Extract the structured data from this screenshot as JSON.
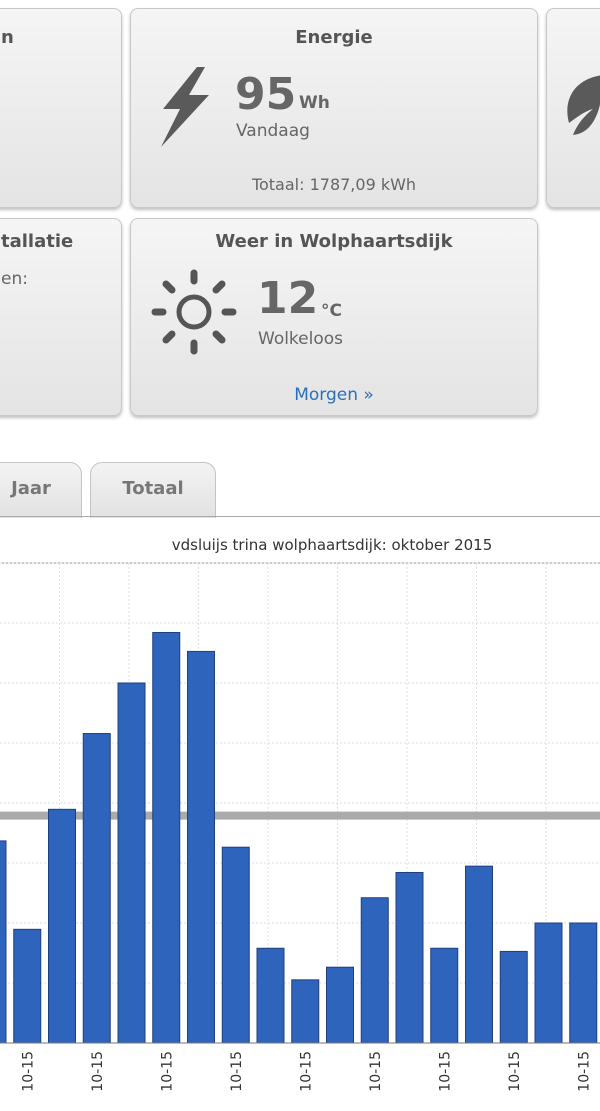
{
  "cards": {
    "left_top_title": "n",
    "energie": {
      "title": "Energie",
      "value": "95",
      "unit": "Wh",
      "label": "Vandaag",
      "total": "Totaal: 1787,09 kWh",
      "icon": "lightning-icon"
    },
    "right_top_icon": "leaf-icon",
    "installatie": {
      "title": "tallatie",
      "line": "en:"
    },
    "weer": {
      "title": "Weer in Wolphaartsdijk",
      "value": "12",
      "unit": "°C",
      "label": "Wolkeloos",
      "link": "Morgen »",
      "icon": "sun-icon"
    }
  },
  "tabs": [
    {
      "label": "Jaar"
    },
    {
      "label": "Totaal"
    }
  ],
  "colors": {
    "bar": "#2f64bd",
    "bar_border": "#1e3f80",
    "link": "#2a6fba",
    "reference_line": "#aaaaaa"
  },
  "chart_data": {
    "type": "bar",
    "title": "vdsluijs trina wolphaartsdijk: oktober 2015",
    "tick_labels": [
      "10-15",
      "10-15",
      "10-15",
      "10-15",
      "10-15",
      "10-15",
      "10-15",
      "10-15",
      "10-15"
    ],
    "values": [
      0.32,
      0.18,
      0.37,
      0.49,
      0.57,
      0.65,
      0.62,
      0.31,
      0.15,
      0.1,
      0.12,
      0.23,
      0.27,
      0.15,
      0.28,
      0.145,
      0.19,
      0.19,
      0.21
    ],
    "average": 0.36,
    "ylim": [
      0,
      0.76
    ],
    "grid": true
  }
}
